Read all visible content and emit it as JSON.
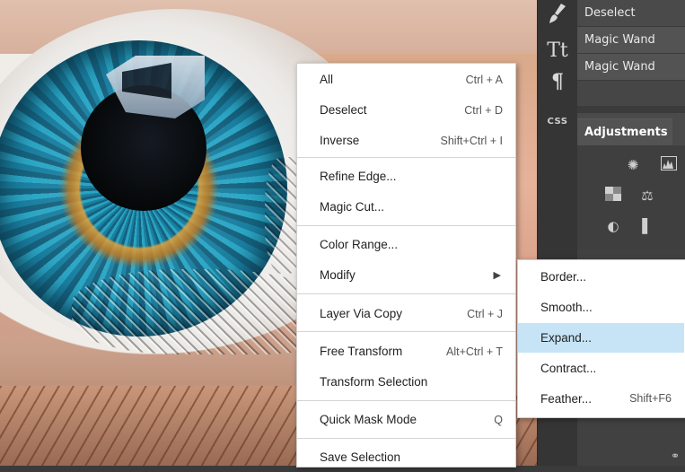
{
  "tools": {
    "brush_icon": "brush-icon",
    "type_glyph": "Tt",
    "paragraph_glyph": "¶",
    "css_label": "CSS"
  },
  "history": {
    "items": [
      {
        "label": "Deselect"
      },
      {
        "label": "Magic Wand"
      },
      {
        "label": "Magic Wand"
      }
    ]
  },
  "adjustments": {
    "tab_label": "Adjustments"
  },
  "menu": {
    "items": [
      {
        "label": "All",
        "shortcut": "Ctrl + A"
      },
      {
        "label": "Deselect",
        "shortcut": "Ctrl + D"
      },
      {
        "label": "Inverse",
        "shortcut": "Shift+Ctrl + I"
      },
      {
        "label": "Refine Edge...",
        "shortcut": ""
      },
      {
        "label": "Magic Cut...",
        "shortcut": ""
      },
      {
        "label": "Color Range...",
        "shortcut": ""
      },
      {
        "label": "Modify",
        "shortcut": "▶"
      },
      {
        "label": "Layer Via Copy",
        "shortcut": "Ctrl + J"
      },
      {
        "label": "Free Transform",
        "shortcut": "Alt+Ctrl + T"
      },
      {
        "label": "Transform Selection",
        "shortcut": ""
      },
      {
        "label": "Quick Mask Mode",
        "shortcut": "Q"
      },
      {
        "label": "Save Selection",
        "shortcut": ""
      }
    ]
  },
  "submenu": {
    "items": [
      {
        "label": "Border...",
        "shortcut": ""
      },
      {
        "label": "Smooth...",
        "shortcut": ""
      },
      {
        "label": "Expand...",
        "shortcut": ""
      },
      {
        "label": "Contract...",
        "shortcut": ""
      },
      {
        "label": "Feather...",
        "shortcut": "Shift+F6"
      }
    ],
    "highlight_color": "#c6e4f6"
  }
}
